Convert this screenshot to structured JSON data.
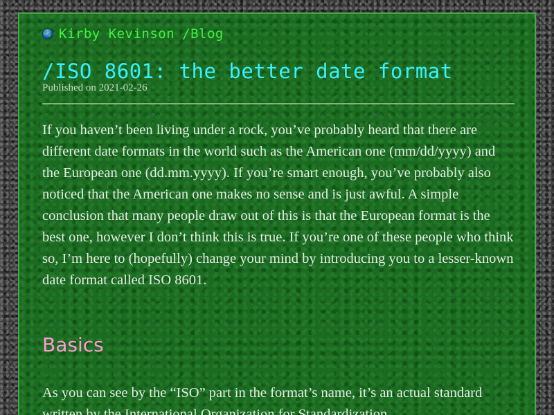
{
  "header": {
    "icon": "globe-icon",
    "site_name": "Kirby Kevinson",
    "section": "/Blog"
  },
  "post": {
    "title": "/ISO 8601: the better date format",
    "published": "Published on 2021-02-26",
    "paragraphs": [
      "If you haven’t been living under a rock, you’ve probably heard that there are different date formats in the world such as the American one (mm/dd/yyyy) and the European one (dd.mm.yyyy). If you’re smart enough, you’ve probably also noticed that the American one makes no sense and is just awful. A simple conclusion that many people draw out of this is that the European format is the best one, however I don’t think this is true. If you’re one of these people who think so, I’m here to (hopefully) change your mind by introducing you to a lesser-known date format called ISO 8601."
    ],
    "sections": [
      {
        "heading": "Basics",
        "paragraph": "As you can see by the “ISO” part in the format’s name, it’s an actual standard written by the International Organization for Standardization"
      }
    ]
  },
  "colors": {
    "page_background": "#1c6b22",
    "border": "#4aa64a",
    "site_link": "#3df53d",
    "title": "#38f0ff",
    "heading": "#ff9ad5",
    "body_text": "#e4ede4",
    "meta_text": "#c9dcc9"
  }
}
